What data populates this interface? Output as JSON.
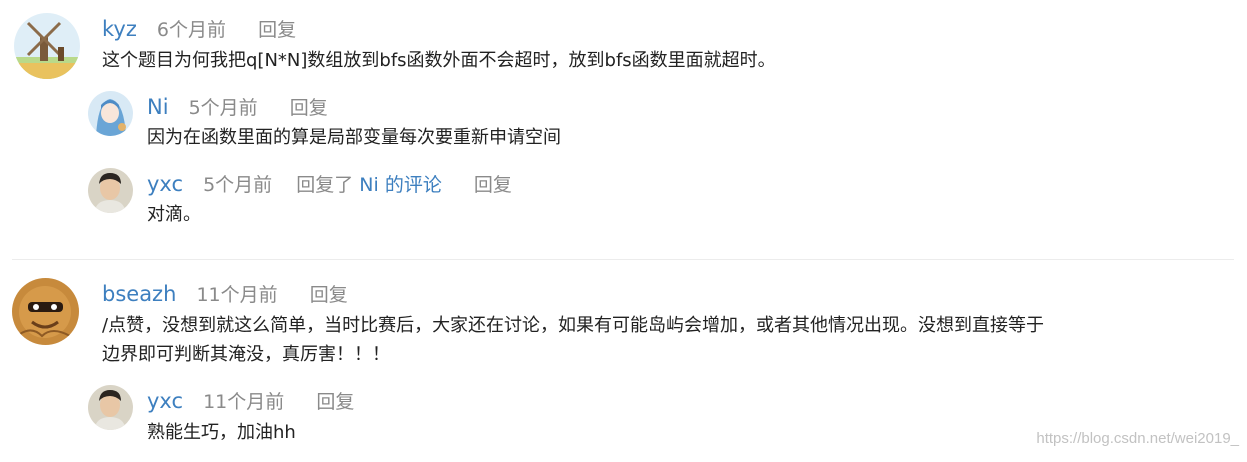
{
  "comments": [
    {
      "author": "kyz",
      "time": "6个月前",
      "reply_label": "回复",
      "text": "这个题目为何我把q[N*N]数组放到bfs函数外面不会超时，放到bfs函数里面就超时。",
      "avatar_icon": "windmill-landscape-avatar",
      "replies": [
        {
          "author": "Ni",
          "time": "5个月前",
          "reply_label": "回复",
          "text": "因为在函数里面的算是局部变量每次要重新申请空间",
          "avatar_icon": "anime-girl-avatar"
        },
        {
          "author": "yxc",
          "time": "5个月前",
          "replied_prefix": "回复了",
          "replied_user": "Ni 的评论",
          "reply_label": "回复",
          "text": "对滴。",
          "avatar_icon": "person-photo-avatar"
        }
      ]
    },
    {
      "author": "bseazh",
      "time": "11个月前",
      "reply_label": "回复",
      "text_line1": "/点赞，没想到就这么简单，当时比赛后，大家还在讨论，如果有可能岛屿会增加，或者其他情况出现。没想到直接等于",
      "text_line2": "边界即可判断其淹没，真厉害！！！",
      "avatar_icon": "raccoon-avatar",
      "replies": [
        {
          "author": "yxc",
          "time": "11个月前",
          "reply_label": "回复",
          "text": "熟能生巧，加油hh",
          "avatar_icon": "person-photo-avatar"
        }
      ]
    }
  ],
  "watermark": "https://blog.csdn.net/wei2019_",
  "colors": {
    "author": "#3d7fbf",
    "meta": "#8a8a8a",
    "text": "#222222",
    "divider": "#ececec"
  }
}
